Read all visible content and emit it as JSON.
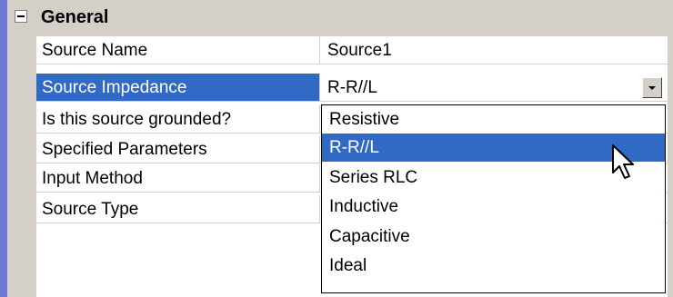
{
  "property_grid": {
    "category": {
      "label": "General",
      "expanded": true,
      "expander_icon": "minus-box-icon"
    },
    "rows": [
      {
        "name": "Source Name",
        "value": "Source1"
      },
      {
        "name": "Source Impedance",
        "value": "R-R//L"
      },
      {
        "name": "Is this source grounded?",
        "value": ""
      },
      {
        "name": "Specified Parameters",
        "value": ""
      },
      {
        "name": "Input Method",
        "value": ""
      },
      {
        "name": "Source Type",
        "value": ""
      }
    ],
    "selected_row": "Source Impedance"
  },
  "dropdown": {
    "options": [
      "Resistive",
      "R-R//L",
      "Series RLC",
      "Inductive",
      "Capacitive",
      "Ideal"
    ],
    "highlighted": "R-R//L",
    "button_icon": "chevron-down-icon"
  },
  "cursor_icon": "mouse-pointer-icon",
  "colors": {
    "selection": "#316ac5",
    "gutter": "#d4d0c8",
    "left_strip": "#6f7ad4"
  }
}
